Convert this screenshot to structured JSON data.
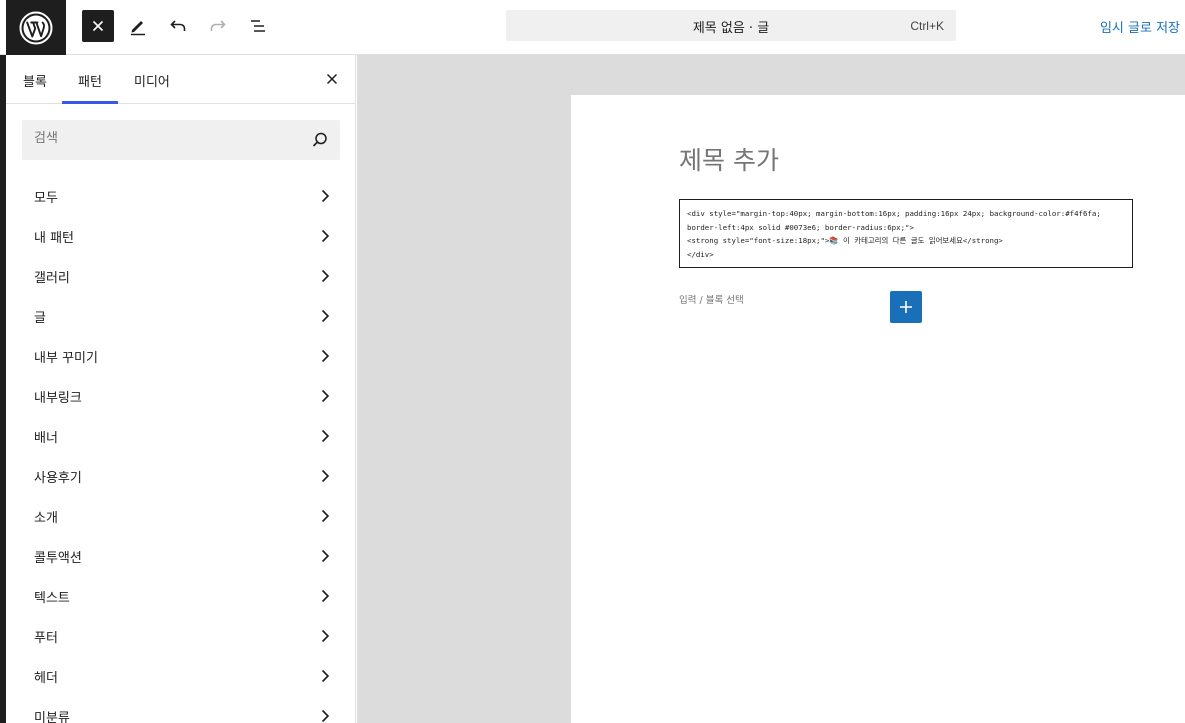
{
  "topbar": {
    "command_title": "제목 없음 · 글",
    "command_shortcut": "Ctrl+K",
    "save_draft": "임시 글로 저장"
  },
  "sidebar": {
    "tabs": [
      "블록",
      "패턴",
      "미디어"
    ],
    "active_tab": "패턴",
    "search_placeholder": "검색",
    "categories": [
      "모두",
      "내 패턴",
      "갤러리",
      "글",
      "내부 꾸미기",
      "내부링크",
      "배너",
      "사용후기",
      "소개",
      "콜투액션",
      "텍스트",
      "푸터",
      "헤더",
      "미분류"
    ]
  },
  "editor": {
    "title_placeholder": "제목 추가",
    "code_lines": [
      "<div style=\"margin-top:40px; margin-bottom:16px; padding:16px 24px; background-color:#f4f6fa;",
      "border-left:4px solid #0073e6; border-radius:6px;\">",
      "<strong style=\"font-size:18px;\">📚 이 카테고리의 다른 글도 읽어보세요</strong>",
      "</div>"
    ],
    "block_hint": "입력 / 블록 선택"
  },
  "colors": {
    "accent": "#1970b8",
    "tab_indicator": "#3858e9",
    "dark": "#1e1e1e",
    "canvas_bg": "#dcdcdc"
  },
  "icons": [
    "wordpress-logo-icon",
    "close-icon",
    "pen-tool-icon",
    "undo-icon",
    "redo-icon",
    "document-overview-icon",
    "search-icon",
    "chevron-right-icon",
    "plus-icon"
  ]
}
